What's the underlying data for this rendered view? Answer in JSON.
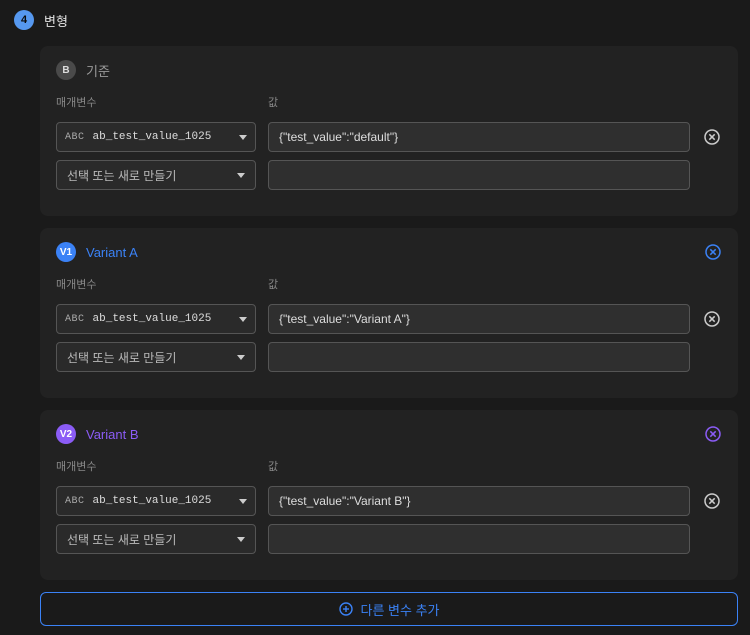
{
  "header": {
    "step": "4",
    "title": "변형"
  },
  "labels": {
    "parameter": "매개변수",
    "value": "값",
    "abc_prefix": "ABC",
    "placeholder_select": "선택 또는 새로 만들기"
  },
  "variants": [
    {
      "badge": "B",
      "badge_class": "badge-b",
      "name": "기준",
      "name_class": "name-b",
      "deletable": false,
      "delete_color": "",
      "rows": [
        {
          "param": "ab_test_value_1025",
          "value": "{\"test_value\":\"default\"}"
        }
      ]
    },
    {
      "badge": "V1",
      "badge_class": "badge-v1",
      "name": "Variant A",
      "name_class": "name-v1",
      "deletable": true,
      "delete_color": "#3b82f6",
      "rows": [
        {
          "param": "ab_test_value_1025",
          "value": "{\"test_value\":\"Variant A\"}"
        }
      ]
    },
    {
      "badge": "V2",
      "badge_class": "badge-v2",
      "name": "Variant B",
      "name_class": "name-v2",
      "deletable": true,
      "delete_color": "#8b5cf6",
      "rows": [
        {
          "param": "ab_test_value_1025",
          "value": "{\"test_value\":\"Variant B\"}"
        }
      ]
    }
  ],
  "footer": {
    "add_variant_label": "다른 변수 추가"
  }
}
